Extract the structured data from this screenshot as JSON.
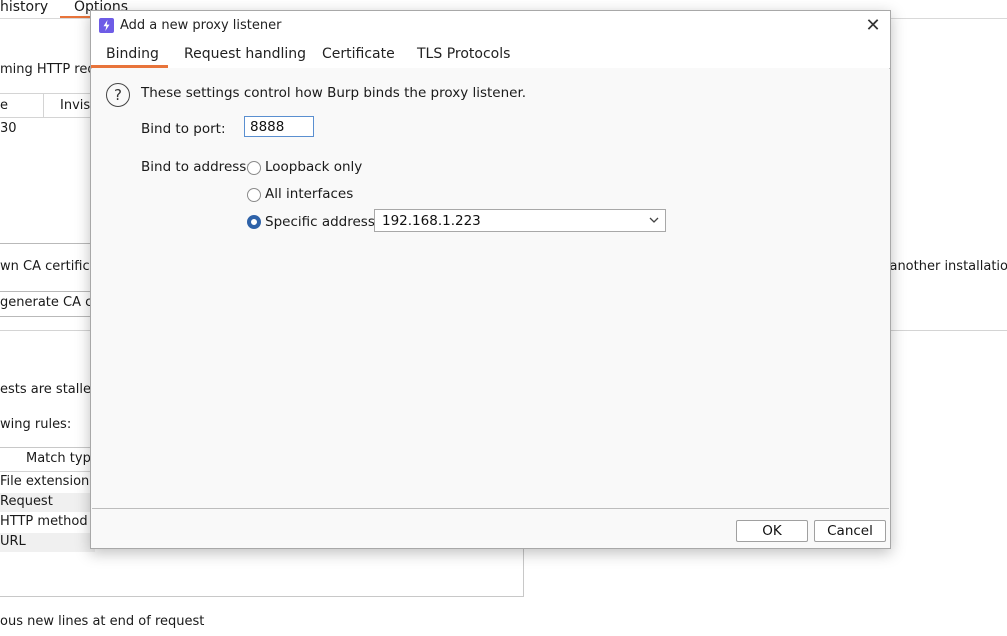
{
  "background": {
    "tabs": [
      "history",
      "Options"
    ],
    "texts": [
      "ming HTTP req",
      "e",
      "Invis",
      "30",
      "wn CA certificat",
      "r another installatio",
      "generate CA ce",
      "ests are stalled",
      "wing rules:",
      "Match typ",
      "File extension",
      "Request",
      "HTTP method",
      "URL",
      "ous new lines at end of request"
    ]
  },
  "dialog": {
    "title": "Add a new proxy listener",
    "close_glyph": "✕",
    "tabs": [
      {
        "label": "Binding",
        "active": true
      },
      {
        "label": "Request handling",
        "active": false
      },
      {
        "label": "Certificate",
        "active": false
      },
      {
        "label": "TLS Protocols",
        "active": false
      }
    ],
    "help_glyph": "?",
    "description": "These settings control how Burp binds the proxy listener.",
    "bind_port_label": "Bind to port:",
    "bind_port_value": "8888",
    "bind_address_label": "Bind to address:",
    "address_options": [
      {
        "label": "Loopback only",
        "selected": false
      },
      {
        "label": "All interfaces",
        "selected": false
      },
      {
        "label": "Specific address:",
        "selected": true
      }
    ],
    "specific_address_value": "192.168.1.223",
    "ok_label": "OK",
    "cancel_label": "Cancel"
  },
  "colors": {
    "accent_tab": "#e8743b",
    "radio_selected": "#2e62a8",
    "app_icon": "#6e5ce6"
  }
}
